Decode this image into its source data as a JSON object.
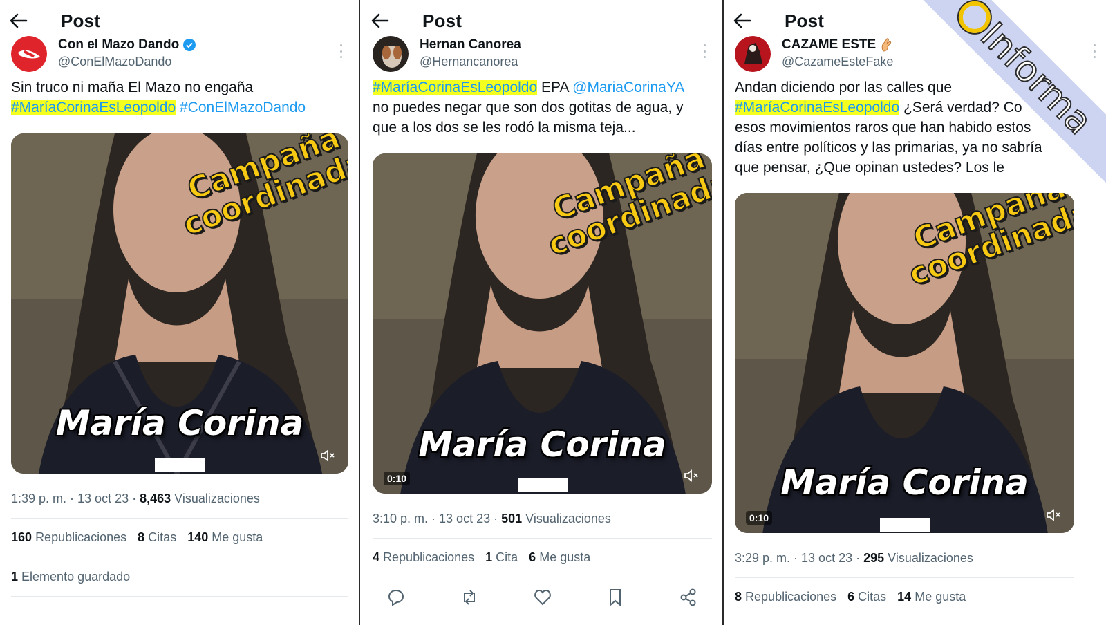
{
  "panels": [
    {
      "header_title": "Post",
      "author_name": "Con el Mazo Dando",
      "author_handle": "@ConElMazoDando",
      "verified": true,
      "text_line1": "Sin truco ni maña El Mazo no engaña",
      "hashtag1": "#MaríaCorinaEsLeopoldo",
      "hashtag2": "#ConElMazoDando",
      "stamp_line1": "Campaña",
      "stamp_line2": "coordinada",
      "video_caption": "María Corina",
      "time": "1:39 p. m. · 13 oct 23 · ",
      "views": "8,463",
      "views_label": " Visualizaciones",
      "reposts": "160",
      "reposts_label": "Republicaciones",
      "quotes": "8",
      "quotes_label": "Citas",
      "likes": "140",
      "likes_label": "Me gusta",
      "saved": "1",
      "saved_label": "Elemento guardado"
    },
    {
      "header_title": "Post",
      "author_name": "Hernan Canorea",
      "author_handle": "@Hernancanorea",
      "hashtag1": "#MaríaCorinaEsLeopoldo",
      "text_after_hashtag": " EPA ",
      "mention": "@MariaCorinaYA",
      "text_line2": "no puedes negar que son dos gotitas de agua, y",
      "text_line3": "que a los dos se les rodó la misma teja...",
      "stamp_line1": "Campaña",
      "stamp_line2": "coordinada",
      "video_caption": "María Corina",
      "duration": "0:10",
      "time": "3:10 p. m. · 13 oct 23 · ",
      "views": "501",
      "views_label": " Visualizaciones",
      "reposts": "4",
      "reposts_label": "Republicaciones",
      "quotes": "1",
      "quotes_label": "Cita",
      "likes": "6",
      "likes_label": "Me gusta",
      "actions": [
        "reply-icon",
        "repost-icon",
        "like-icon",
        "bookmark-icon",
        "share-icon"
      ]
    },
    {
      "header_title": "Post",
      "author_name": "CAZAME ESTE",
      "author_handle": "@CazameEsteFake",
      "text_line1": "Andan diciendo por las calles que",
      "hashtag1": "#MaríaCorinaEsLeopoldo",
      "text_after_hashtag": " ¿Será verdad? Co",
      "text_line3": "esos movimientos raros que han habido estos",
      "text_line4": "días entre políticos y las primarias, ya no sabría",
      "text_line5": "que pensar, ¿Que opinan ustedes? Los le",
      "stamp_line1": "Campaña",
      "stamp_line2": "coordinada",
      "video_caption": "María Corina",
      "duration": "0:10",
      "time": "3:29 p. m. · 13 oct 23 · ",
      "views": "295",
      "views_label": " Visualizaciones",
      "reposts": "8",
      "reposts_label": "Republicaciones",
      "quotes": "6",
      "quotes_label": "Citas",
      "likes": "14",
      "likes_label": "Me gusta"
    }
  ],
  "watermark": "Informa",
  "colors": {
    "link": "#1d9bf0",
    "highlight": "#f4ff1f",
    "stamp": "#f7c912",
    "ribbon": "#cdd4f2"
  }
}
